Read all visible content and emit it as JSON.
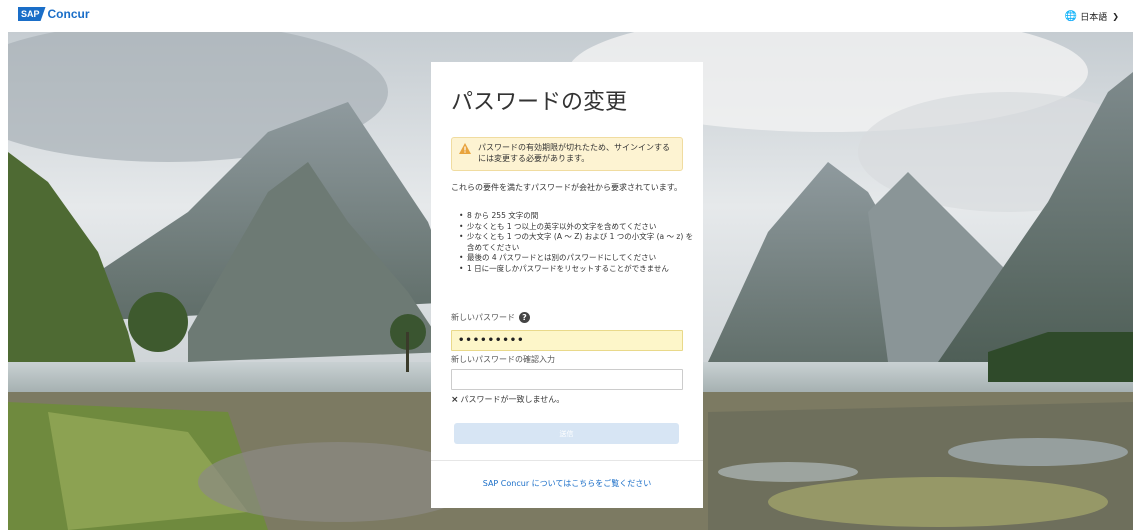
{
  "header": {
    "logo_sap": "SAP",
    "logo_concur": "Concur",
    "language_label": "日本語"
  },
  "card": {
    "title": "パスワードの変更",
    "alert_text": "パスワードの有効期限が切れたため、サインインするには変更する必要があります。",
    "requirements_intro": "これらの要件を満たすパスワードが会社から要求されています。",
    "requirements": [
      "8 から 255 文字の間",
      "少なくとも 1 つ以上の英字以外の文字を含めてください",
      "少なくとも 1 つの大文字 (A ～ Z) および 1 つの小文字 (a ～ z) を含めてください",
      "最後の 4 パスワードとは別のパスワードにしてください",
      "1 日に一度しかパスワードをリセットすることができません"
    ],
    "new_password_label": "新しいパスワード",
    "new_password_value": "•••••••••",
    "confirm_password_label": "新しいパスワードの確認入力",
    "confirm_password_value": "",
    "error_text": "パスワードが一致しません。",
    "submit_label": "送信",
    "footer_link": "SAP Concur についてはこちらをご覧ください"
  },
  "colors": {
    "brand": "#1a6ec8",
    "alert_bg": "#fdf3d2",
    "warning_icon": "#e8a33d",
    "button_disabled": "#d7e5f4",
    "input_filled_bg": "#fdf6c9"
  }
}
